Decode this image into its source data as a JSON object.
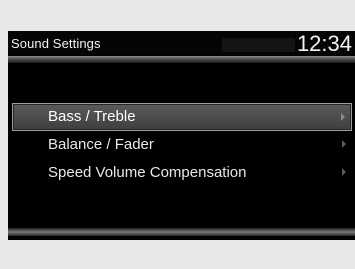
{
  "header": {
    "title": "Sound Settings",
    "time": "12:34"
  },
  "menu": {
    "items": [
      {
        "label": "Bass / Treble",
        "selected": true
      },
      {
        "label": "Balance / Fader",
        "selected": false
      },
      {
        "label": "Speed Volume Compensation",
        "selected": false
      }
    ]
  },
  "icons": {
    "item_arrow": "chevron-right-icon"
  },
  "colors": {
    "screen_background": "#000000",
    "text": "#e8e8e8",
    "selected_background": "#4d4d4d",
    "selected_border": "#9c9c9c"
  }
}
